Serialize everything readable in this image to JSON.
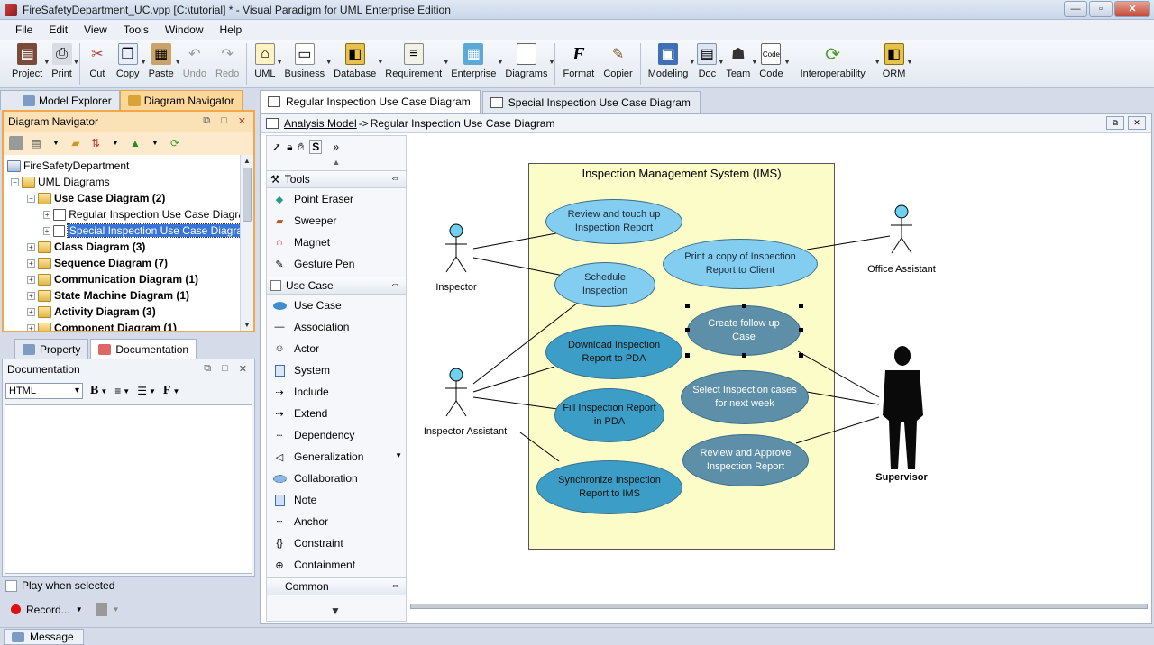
{
  "window": {
    "title": "FireSafetyDepartment_UC.vpp [C:\\tutorial] * - Visual Paradigm for UML Enterprise Edition",
    "minimize": "—",
    "maximize": "▫",
    "close": "✕"
  },
  "menu": [
    "File",
    "Edit",
    "View",
    "Tools",
    "Window",
    "Help"
  ],
  "toolbar": {
    "project": "Project",
    "print": "Print",
    "cut": "Cut",
    "copy": "Copy",
    "paste": "Paste",
    "undo": "Undo",
    "redo": "Redo",
    "uml": "UML",
    "business": "Business",
    "database": "Database",
    "requirement": "Requirement",
    "enterprise": "Enterprise",
    "diagrams": "Diagrams",
    "format": "Format",
    "copier": "Copier",
    "modeling": "Modeling",
    "doc": "Doc",
    "team": "Team",
    "code": "Code",
    "interoperability": "Interoperability",
    "orm": "ORM"
  },
  "left_tabs": {
    "model_explorer": "Model Explorer",
    "diagram_navigator": "Diagram Navigator"
  },
  "navigator": {
    "title": "Diagram Navigator",
    "root": "FireSafetyDepartment",
    "uml_diagrams": "UML Diagrams",
    "use_case_group": "Use Case Diagram (2)",
    "regular_diagram": "Regular Inspection Use Case Diagram",
    "special_diagram": "Special Inspection Use Case Diagram",
    "class_group": "Class Diagram (3)",
    "sequence_group": "Sequence Diagram (7)",
    "communication_group": "Communication Diagram (1)",
    "state_machine_group": "State Machine Diagram (1)",
    "activity_group": "Activity Diagram (3)",
    "component_group": "Component Diagram (1)"
  },
  "bottom_tabs": {
    "property": "Property",
    "documentation": "Documentation"
  },
  "documentation": {
    "title": "Documentation",
    "format": "HTML",
    "bold": "B",
    "font": "F",
    "play_when_selected": "Play when selected",
    "record": "Record..."
  },
  "status": {
    "message": "Message"
  },
  "editor_tabs": {
    "regular": "Regular Inspection Use Case Diagram",
    "special": "Special Inspection Use Case Diagram"
  },
  "breadcrumb": {
    "model": "Analysis Model",
    "separator": "->",
    "diagram": "Regular Inspection Use Case Diagram"
  },
  "palette": {
    "s_tool": "S",
    "tools_group": "Tools",
    "point_eraser": "Point Eraser",
    "sweeper": "Sweeper",
    "magnet": "Magnet",
    "gesture_pen": "Gesture Pen",
    "use_case_group": "Use Case",
    "use_case": "Use Case",
    "association": "Association",
    "actor": "Actor",
    "system": "System",
    "include": "Include",
    "extend": "Extend",
    "dependency": "Dependency",
    "generalization": "Generalization",
    "collaboration": "Collaboration",
    "note": "Note",
    "anchor": "Anchor",
    "constraint": "Constraint",
    "containment": "Containment",
    "common_group": "Common"
  },
  "diagram": {
    "system_title": "Inspection Management System (IMS)",
    "actors": {
      "inspector": "Inspector",
      "inspector_assistant": "Inspector Assistant",
      "office_assistant": "Office Assistant",
      "supervisor": "Supervisor"
    },
    "use_cases": {
      "review_touch_up": "Review and touch up Inspection Report",
      "schedule": "Schedule Inspection",
      "print_copy": "Print a copy of Inspection Report to Client",
      "follow_up": "Create follow up Case",
      "download": "Download Inspection Report to PDA",
      "select_cases": "Select Inspection cases for next week",
      "fill": "Fill Inspection Report in PDA",
      "review_approve": "Review and Approve Inspection Report",
      "synchronize": "Synchronize Inspection Report to IMS"
    }
  }
}
